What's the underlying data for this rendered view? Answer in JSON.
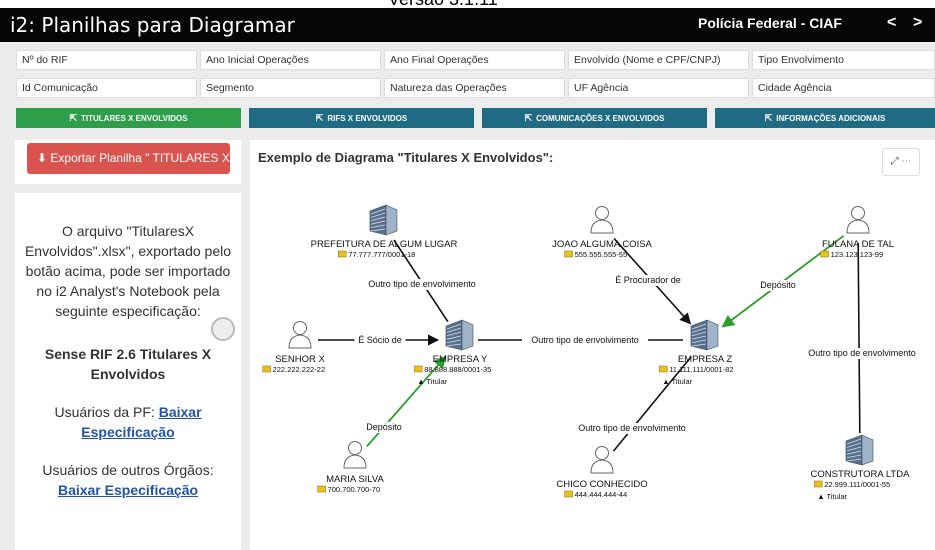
{
  "version_text": "Versão 3.1.11",
  "header": {
    "title": "i2: Planilhas para Diagramar",
    "org": "Polícia Federal - CIAF",
    "prev": "<",
    "next": ">"
  },
  "fields_row1": [
    "Nº do RIF",
    "Ano Inicial Operações",
    "Ano Final Operações",
    "Envolvido (Nome e CPF/CNPJ)",
    "Tipo Envolvimento"
  ],
  "fields_row2": [
    "Id Comunicação",
    "Segmento",
    "Natureza das Operações",
    "UF Agência",
    "Cidade Agência"
  ],
  "tabs": [
    {
      "label": "TITULARES X ENVOLVIDOS",
      "color": "#2e9e4a"
    },
    {
      "label": "RIFS X ENVOLVIDOS",
      "color": "#1f6b84"
    },
    {
      "label": "COMUNICAÇÕES X ENVOLVIDOS",
      "color": "#1f6b84"
    },
    {
      "label": "INFORMAÇÕES ADICIONAIS",
      "color": "#1f6b84"
    }
  ],
  "export_button": "Exportar Planilha \" TITULARES X ENVOLVIDOS \"",
  "info": {
    "description": "O arquivo \"TitularesX Envolvidos\".xlsx\", exportado pelo botão acima, pode ser importado no i2 Analyst's Notebook pela seguinte especificação:",
    "spec": "Sense RIF 2.6 Titulares X Envolvidos",
    "pf_label": "Usuários da PF: ",
    "pf_link": "Baixar Especificação",
    "other_label": "Usuários de outros Órgãos:",
    "other_link": "Baixar Especificação"
  },
  "diagram": {
    "title": "Exemplo de Diagrama \"Titulares X Envolvidos\":",
    "expand_icon": "expand-icon",
    "more_icon": "more-icon",
    "titular_label": "Titular",
    "nodes": [
      {
        "id": "prefeitura",
        "name": "PREFEITURA DE ALGUM LUGAR",
        "doc": "77.777.777/0001-18",
        "icon": "building-icon"
      },
      {
        "id": "joao",
        "name": "JOAO ALGUMA COISA",
        "doc": "555.555.555-55",
        "icon": "person-icon"
      },
      {
        "id": "fulana",
        "name": "FULANA DE TAL",
        "doc": "123.123.123-99",
        "icon": "person-icon"
      },
      {
        "id": "senhor",
        "name": "SENHOR X",
        "doc": "222.222.222-22",
        "icon": "person-icon"
      },
      {
        "id": "empy",
        "name": "EMPRESA Y",
        "doc": "88.888.888/0001-35",
        "icon": "building-icon",
        "titular": true
      },
      {
        "id": "empz",
        "name": "EMPRESA Z",
        "doc": "11.111.111/0001-82",
        "icon": "building-icon",
        "titular": true
      },
      {
        "id": "maria",
        "name": "MARIA SILVA",
        "doc": "700.700.700-70",
        "icon": "person-icon"
      },
      {
        "id": "chico",
        "name": "CHICO CONHECIDO",
        "doc": "444.444.444-44",
        "icon": "person-icon"
      },
      {
        "id": "construtora",
        "name": "CONSTRUTORA LTDA",
        "doc": "22.999.111/0001-55",
        "icon": "building-icon",
        "titular": true
      }
    ],
    "edges": [
      {
        "from": "prefeitura",
        "to": "empy",
        "label": "Outro tipo de envolvimento"
      },
      {
        "from": "senhor",
        "to": "empy",
        "label": "É Sócio de"
      },
      {
        "from": "empy",
        "to": "empz",
        "label": "Outro tipo de envolvimento"
      },
      {
        "from": "maria",
        "to": "empy",
        "label": "Depósito"
      },
      {
        "from": "joao",
        "to": "empz",
        "label": "É Procurador de"
      },
      {
        "from": "fulana",
        "to": "empz",
        "label": "Depósito"
      },
      {
        "from": "chico",
        "to": "empz",
        "label": "Outro tipo de envolvimento"
      },
      {
        "from": "fulana",
        "to": "construtora",
        "label": "Outro tipo de envolvimento"
      }
    ]
  }
}
